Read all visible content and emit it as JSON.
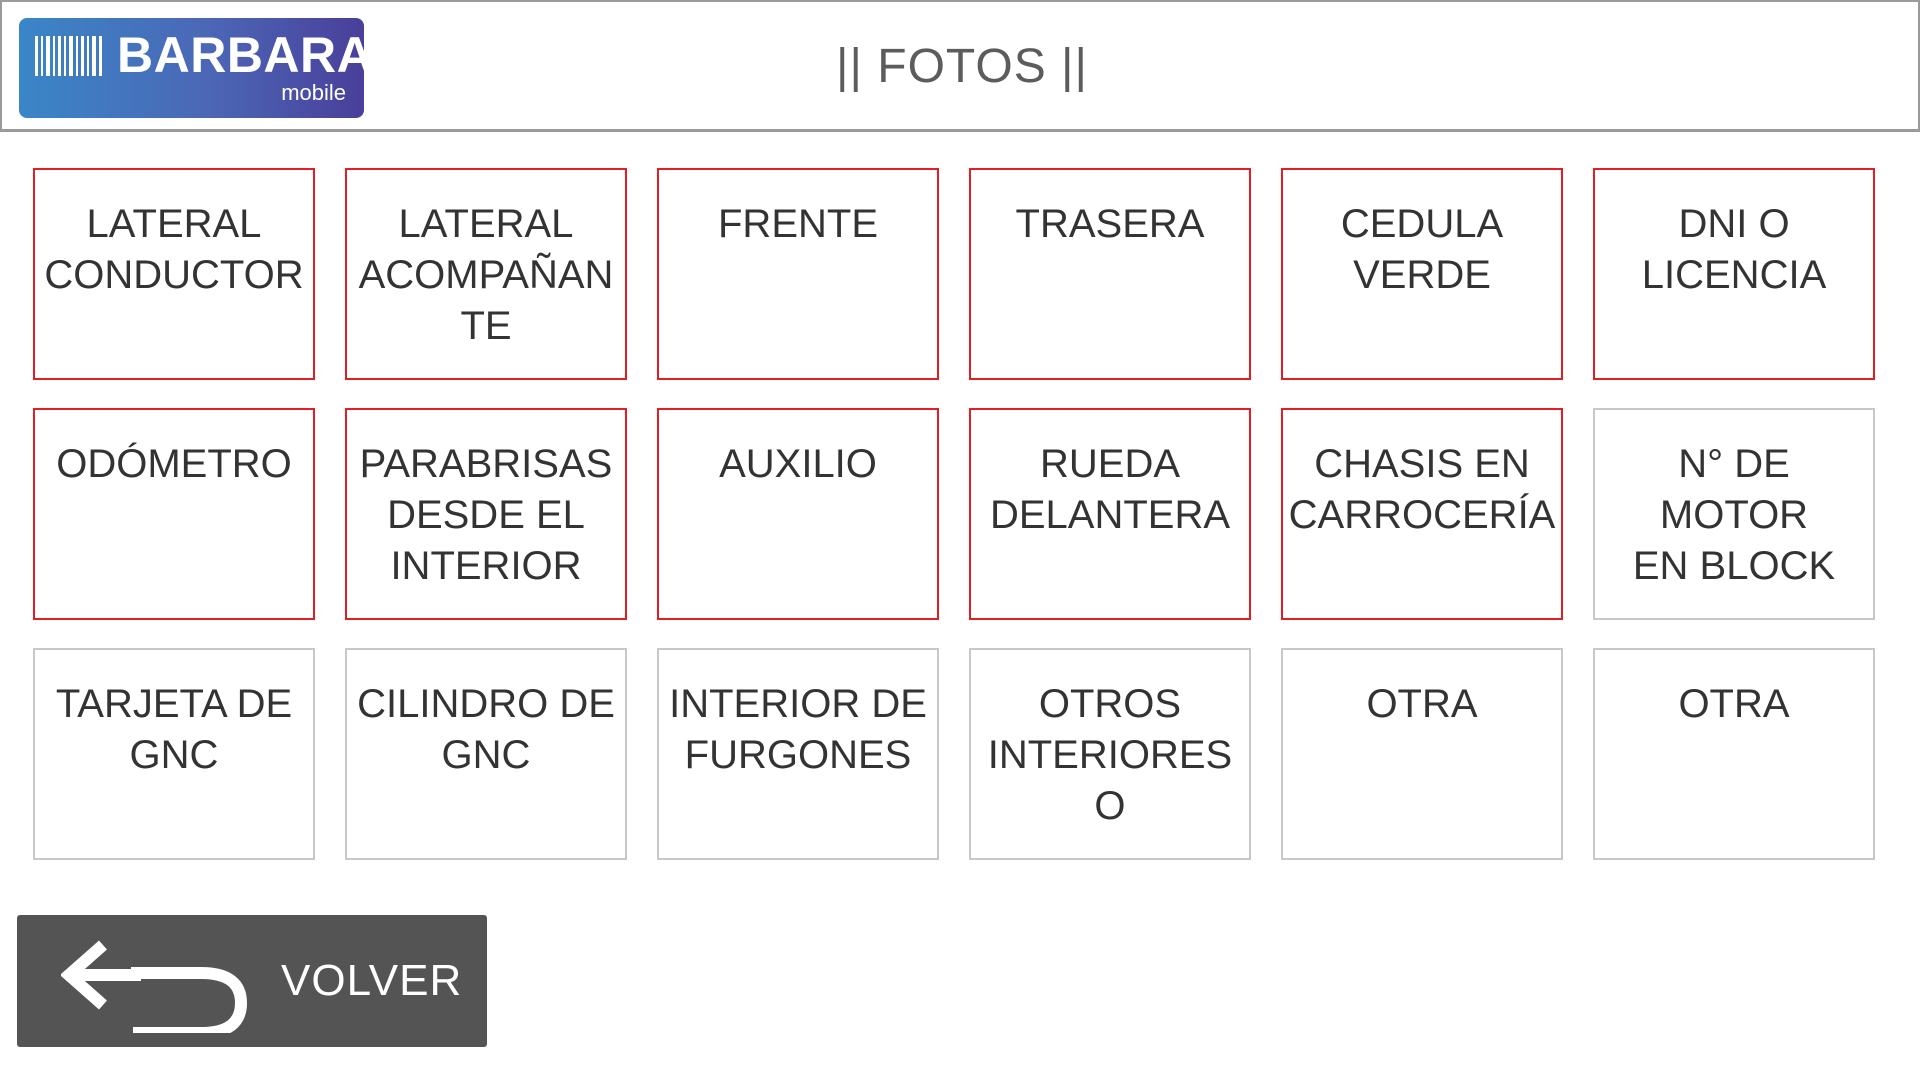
{
  "header": {
    "logo_brand": "BARBARA",
    "logo_sub": "mobile",
    "title": "|| FOTOS ||"
  },
  "colors": {
    "required_border": "#e01e24",
    "optional_border": "#c8c8c8",
    "back_button_bg": "#545454"
  },
  "tiles": [
    {
      "label": "LATERAL\nCONDUCTOR",
      "required": true
    },
    {
      "label": "LATERAL\nACOMPAÑAN\nTE",
      "required": true
    },
    {
      "label": "FRENTE",
      "required": true
    },
    {
      "label": "TRASERA",
      "required": true
    },
    {
      "label": "CEDULA\nVERDE",
      "required": true
    },
    {
      "label": "DNI O\nLICENCIA",
      "required": true
    },
    {
      "label": "ODÓMETRO",
      "required": true
    },
    {
      "label": "PARABRISAS\nDESDE EL\nINTERIOR",
      "required": true
    },
    {
      "label": "AUXILIO",
      "required": true
    },
    {
      "label": "RUEDA\nDELANTERA",
      "required": true
    },
    {
      "label": "CHASIS EN\nCARROCERÍA",
      "required": true
    },
    {
      "label": "N° DE MOTOR\nEN BLOCK",
      "required": false
    },
    {
      "label": "TARJETA DE\nGNC",
      "required": false
    },
    {
      "label": "CILINDRO DE\nGNC",
      "required": false
    },
    {
      "label": "INTERIOR DE\nFURGONES",
      "required": false
    },
    {
      "label": "OTROS\nINTERIORES\nO",
      "required": false
    },
    {
      "label": "OTRA",
      "required": false
    },
    {
      "label": "OTRA",
      "required": false
    }
  ],
  "footer": {
    "back_label": "VOLVER",
    "back_icon": "return-arrow-icon"
  }
}
